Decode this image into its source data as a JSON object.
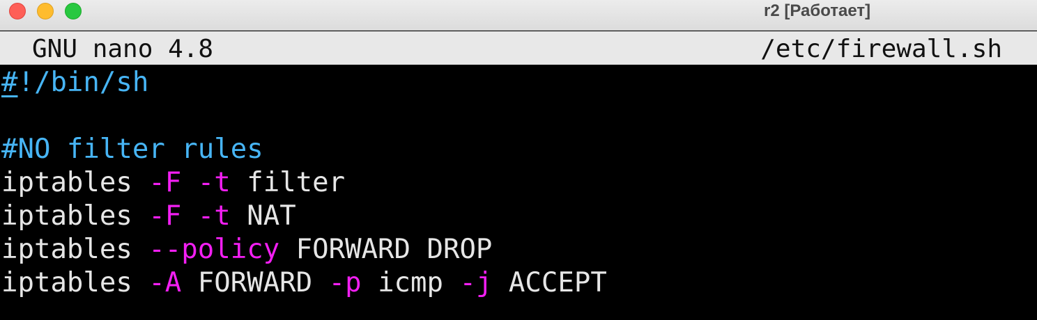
{
  "window": {
    "title": "r2 [Работает]",
    "buttons": [
      "close",
      "minimize",
      "maximize"
    ]
  },
  "nano": {
    "version": "GNU nano 4.8",
    "filename": "/etc/firewall.sh"
  },
  "colors": {
    "comment": "#47b5f5",
    "flag": "#f21ff2",
    "text": "#e6e6e6",
    "background": "#000000",
    "header_bg": "#e8e8e8"
  },
  "editor": {
    "lines": [
      {
        "segments": [
          {
            "text": "#",
            "style": "comment",
            "cursor": true
          },
          {
            "text": "!/bin/sh",
            "style": "comment"
          }
        ]
      },
      {
        "segments": []
      },
      {
        "segments": [
          {
            "text": "#NO filter rules",
            "style": "comment"
          }
        ]
      },
      {
        "segments": [
          {
            "text": "iptables ",
            "style": "plain"
          },
          {
            "text": "-F",
            "style": "flag"
          },
          {
            "text": " ",
            "style": "plain"
          },
          {
            "text": "-t",
            "style": "flag"
          },
          {
            "text": " filter",
            "style": "plain"
          }
        ]
      },
      {
        "segments": [
          {
            "text": "iptables ",
            "style": "plain"
          },
          {
            "text": "-F",
            "style": "flag"
          },
          {
            "text": " ",
            "style": "plain"
          },
          {
            "text": "-t",
            "style": "flag"
          },
          {
            "text": " NAT",
            "style": "plain"
          }
        ]
      },
      {
        "segments": [
          {
            "text": "iptables ",
            "style": "plain"
          },
          {
            "text": "--policy",
            "style": "flag"
          },
          {
            "text": " FORWARD DROP",
            "style": "plain"
          }
        ]
      },
      {
        "segments": [
          {
            "text": "iptables ",
            "style": "plain"
          },
          {
            "text": "-A",
            "style": "flag"
          },
          {
            "text": " FORWARD ",
            "style": "plain"
          },
          {
            "text": "-p",
            "style": "flag"
          },
          {
            "text": " icmp ",
            "style": "plain"
          },
          {
            "text": "-j",
            "style": "flag"
          },
          {
            "text": " ACCEPT",
            "style": "plain"
          }
        ]
      }
    ]
  }
}
